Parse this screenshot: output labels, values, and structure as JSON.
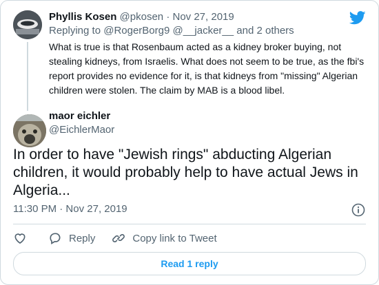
{
  "parent": {
    "name": "Phyllis Kosen",
    "handle": "@pkosen",
    "separator": " · ",
    "date": "Nov 27, 2019",
    "replying_prefix": "Replying to ",
    "replying_to_1": "@RogerBorg9",
    "replying_to_2": "@__jacker__",
    "replying_suffix": " and 2 others",
    "text": "What is true is that Rosenbaum acted as a kidney broker buying, not stealing kidneys, from Israelis. What does not seem to be true, as the fbi's report provides no evidence for it, is that kidneys from \"missing\" Algerian children were stolen.  The claim by MAB is a blood libel."
  },
  "tweet": {
    "name": "maor eichler",
    "handle": "@EichlerMaor",
    "text": "In order to have \"Jewish rings\" abducting Algerian children, it would probably help to have actual Jews in Algeria...",
    "timestamp": "11:30 PM · Nov 27, 2019"
  },
  "actions": {
    "reply_label": "Reply",
    "copy_link_label": "Copy link to Tweet"
  },
  "read_replies_label": "Read 1 reply",
  "colors": {
    "accent": "#1d9bf0",
    "text": "#0f1419",
    "muted": "#536471",
    "border": "#cfd9de"
  },
  "icons": [
    "twitter-logo-icon",
    "info-icon",
    "heart-icon",
    "reply-icon",
    "link-icon"
  ]
}
